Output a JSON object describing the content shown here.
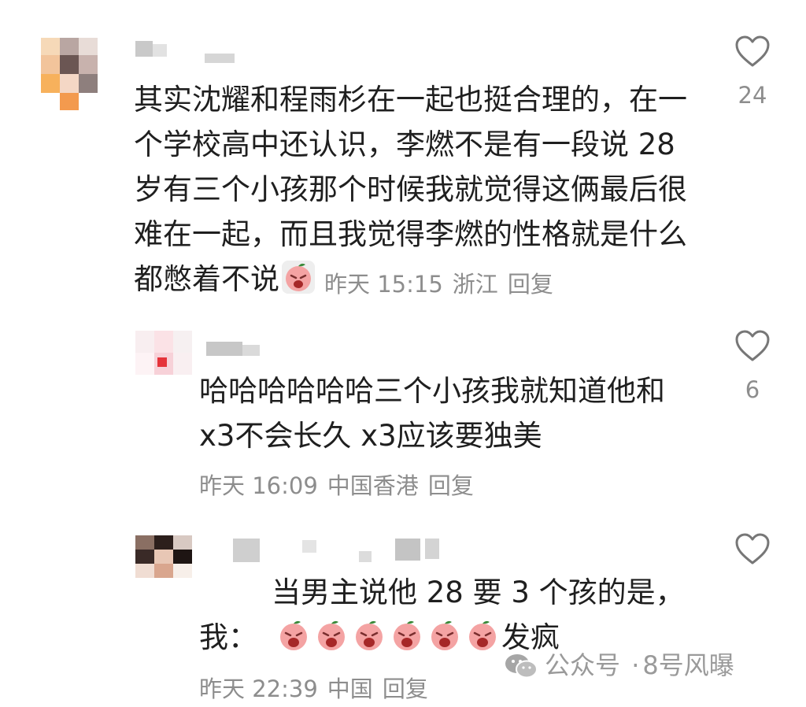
{
  "comments": [
    {
      "text_lines": [
        "其实沈耀和程雨杉在一起也挺合理的，在一",
        "个学校高中还认识，李燃不是有一段说 28",
        "岁有三个小孩那个时候我就觉得这俩最后很",
        "难在一起，而且我觉得李燃的性格就是什么",
        "都憋着不说"
      ],
      "emoji": "crying-peach-emoji",
      "time": "昨天 15:15",
      "location": "浙江",
      "reply_label": "回复",
      "likes": "24"
    },
    {
      "text_lines": [
        "哈哈哈哈哈哈三个小孩我就知道他和",
        "x3不会长久 x3应该要独美"
      ],
      "time": "昨天 16:09",
      "location": "中国香港",
      "reply_label": "回复",
      "likes": "6"
    },
    {
      "text_lines": [
        "当男主说他 28 要 3 个孩的是，",
        "我："
      ],
      "tail_text": "发疯",
      "emoji": "screaming-peach-emoji",
      "emoji_count": 6,
      "time": "昨天 22:39",
      "location": "中国",
      "reply_label": "回复",
      "likes": ""
    }
  ],
  "watermark": {
    "prefix": "公众号",
    "separator": "·",
    "name": "8号风曝",
    "icon": "wechat-icon"
  },
  "colors": {
    "text": "#1f1f1f",
    "meta": "#8d8d8d",
    "emoji_face": "#f4a3a3",
    "emoji_leaf": "#3a8a3a"
  }
}
